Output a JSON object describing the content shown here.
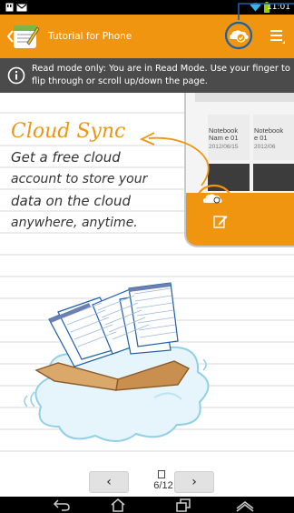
{
  "status_bar": {
    "time": "11:01",
    "icons": [
      "notification-icon",
      "gmail-icon",
      "wifi-icon",
      "battery-icon"
    ]
  },
  "action_bar": {
    "title": "Tutorial for Phone",
    "back_icon": "chevron-left-icon",
    "cloud_sync_icon": "cloud-sync-icon",
    "menu_icon": "overflow-menu-icon",
    "accent_color": "#f0950f"
  },
  "banner": {
    "icon": "info-icon",
    "text": "Read mode only: You are in Read Mode. Use your finger to flip through or scroll up/down the page.",
    "background": "#4b4b4b"
  },
  "tutorial": {
    "title": "Cloud Sync",
    "lines": [
      "Get a free cloud",
      "account to store your",
      "data on the cloud",
      "anywhere, anytime."
    ]
  },
  "tablet_preview": {
    "notebooks": [
      {
        "name": "Notebook Nam e 01",
        "date": "2012/06/15"
      },
      {
        "name": "Notebook e 01",
        "date": "2012/06"
      }
    ]
  },
  "pager": {
    "prev_label": "‹",
    "next_label": "›",
    "page_label": "6/12",
    "current_page": 6,
    "total_pages": 12
  },
  "nav_bar": {
    "buttons": [
      "back-icon",
      "home-icon",
      "recents-icon",
      "expand-icon"
    ]
  }
}
